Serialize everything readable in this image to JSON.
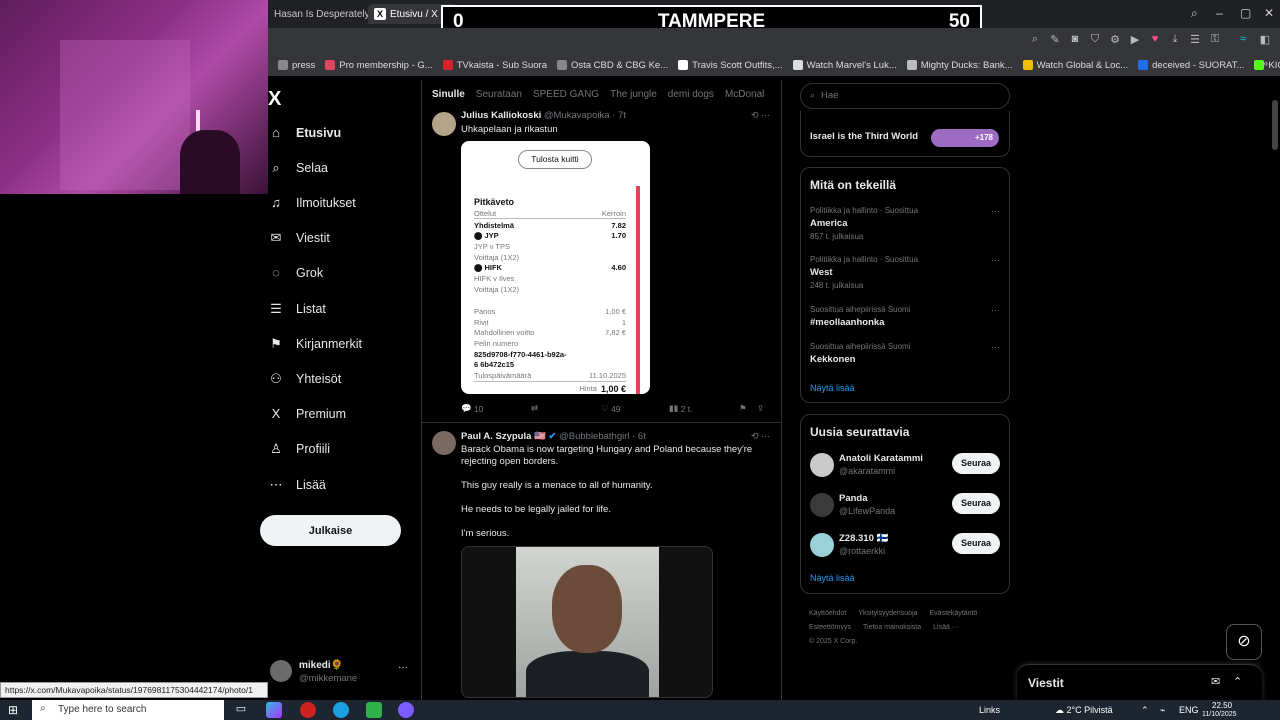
{
  "browser": {
    "tabs": [
      {
        "label": "Hasan Is Desperately Tryin"
      },
      {
        "label": "Etusivu / X"
      }
    ],
    "bookmarks": [
      {
        "label": "press",
        "color": "#888"
      },
      {
        "label": "Pro membership - G...",
        "color": "#e0455e"
      },
      {
        "label": "TVkaista - Sub Suora",
        "color": "#d4232a"
      },
      {
        "label": "Osta CBD & CBG Ke...",
        "color": "#888"
      },
      {
        "label": "Travis Scott Outfits,...",
        "color": "#fff"
      },
      {
        "label": "Watch Marvel's Luk...",
        "color": "#ddd"
      },
      {
        "label": "Mighty Ducks: Bank...",
        "color": "#bbb"
      },
      {
        "label": "Watch Global & Loc...",
        "color": "#f0c000"
      },
      {
        "label": "deceived - SUORAT...",
        "color": "#1d6ff0"
      },
      {
        "label": "KICK Status Page",
        "color": "#53fc18"
      }
    ],
    "status_url": "https://x.com/Mukavapoika/status/1976981175304442174/photo/1"
  },
  "scoreboard": {
    "left": "0",
    "title": "TAMMPERE",
    "right": "50"
  },
  "nav": {
    "logo": "X",
    "items": [
      {
        "label": "Etusivu",
        "icon": "home-icon",
        "glyph": "⌂"
      },
      {
        "label": "Selaa",
        "icon": "search-icon",
        "glyph": "⌕"
      },
      {
        "label": "Ilmoitukset",
        "icon": "bell-icon",
        "glyph": "♫"
      },
      {
        "label": "Viestit",
        "icon": "mail-icon",
        "glyph": "✉"
      },
      {
        "label": "Grok",
        "icon": "grok-icon",
        "glyph": "◌"
      },
      {
        "label": "Listat",
        "icon": "list-icon",
        "glyph": "☰"
      },
      {
        "label": "Kirjanmerkit",
        "icon": "bookmark-icon",
        "glyph": "⚑"
      },
      {
        "label": "Yhteisöt",
        "icon": "people-icon",
        "glyph": "⚇"
      },
      {
        "label": "Premium",
        "icon": "x-icon",
        "glyph": "X"
      },
      {
        "label": "Profiili",
        "icon": "profile-icon",
        "glyph": "♙"
      },
      {
        "label": "Lisää",
        "icon": "more-icon",
        "glyph": "⋯"
      }
    ],
    "post_label": "Julkaise",
    "account": {
      "name": "mikedi🌻",
      "handle": "@mikkemane"
    }
  },
  "feed": {
    "tabs": [
      "Sinulle",
      "Seurataan",
      "SPEED GANG",
      "The jungle",
      "demi dogs",
      "McDonal"
    ],
    "tweet1": {
      "name": "Julius Kalliokoski",
      "handle": "@Mukavapoika · 7t",
      "text": "Uhkapelaan ja rikastun",
      "receipt": {
        "button": "Tulosta kuitti",
        "title": "Pitkäveto",
        "col_left": "Ottelut",
        "col_right": "Kerroin",
        "rows": [
          {
            "l": "Yhdistelmä",
            "r": "7.82",
            "cls": "bold"
          },
          {
            "l": "⬤ JYP",
            "r": "1.70",
            "cls": "bold"
          },
          {
            "l": "JYP v TPS",
            "r": "",
            "cls": "muted"
          },
          {
            "l": "Voittaja (1X2)",
            "r": "",
            "cls": "muted"
          },
          {
            "l": "⬤ HIFK",
            "r": "4.60",
            "cls": "bold"
          },
          {
            "l": "HIFK v Ilves",
            "r": "",
            "cls": "muted"
          },
          {
            "l": "Voittaja (1X2)",
            "r": "",
            "cls": "muted"
          },
          {
            "l": "Panos",
            "r": "1,00 €",
            "cls": "muted"
          },
          {
            "l": "Rivit",
            "r": "1",
            "cls": "muted"
          },
          {
            "l": "Mahdollinen voitto",
            "r": "7,82 €",
            "cls": "muted"
          },
          {
            "l": "Pelin numero",
            "r": "",
            "cls": "muted"
          },
          {
            "l": "825d9708-f770-4461-b92a-",
            "r": "",
            "cls": "bold"
          },
          {
            "l": "6  6b472c15",
            "r": "",
            "cls": "bold"
          },
          {
            "l": "Tulospäivämäärä",
            "r": "11.10.2025",
            "cls": "muted"
          }
        ],
        "price_label": "Hinta",
        "price": "1,00 €"
      },
      "replies": "10",
      "reposts": "",
      "likes": "49",
      "views": "2 t."
    },
    "tweet2": {
      "name": "Paul A. Szypula 🇺🇸",
      "handle": "@Bubblebathgirl · 6t",
      "paragraphs": [
        "Barack Obama is now targeting Hungary and Poland because they're rejecting open borders.",
        "This guy really is a menace to all of humanity.",
        "He needs to be legally jailed for life.",
        "I'm serious."
      ]
    }
  },
  "side": {
    "search_placeholder": "Hae",
    "top_trend": {
      "title": "Israel is the Third World",
      "count": "+178"
    },
    "trends_title": "Mitä on tekeillä",
    "trends": [
      {
        "cat": "Politiikka ja hallinto · Suosittua",
        "title": "America",
        "count": "857 t. julkaisua"
      },
      {
        "cat": "Politiikka ja hallinto · Suosittua",
        "title": "West",
        "count": "248 t. julkaisua"
      },
      {
        "cat": "Suosittua aihepiirissä Suomi",
        "title": "#meollaanhonka",
        "count": ""
      },
      {
        "cat": "Suosittua aihepiirissä Suomi",
        "title": "Kekkonen",
        "count": ""
      }
    ],
    "show_more": "Näytä lisää",
    "follow_title": "Uusia seurattavia",
    "follows": [
      {
        "name": "Anatoli Karatammi",
        "handle": "@akaratammi",
        "btn": "Seuraa"
      },
      {
        "name": "Panda",
        "handle": "@LifewPanda",
        "btn": "Seuraa"
      },
      {
        "name": "Z28.310 🇫🇮",
        "handle": "@rottaerkki",
        "btn": "Seuraa"
      }
    ],
    "show_more2": "Näytä lisää",
    "footer": [
      "Käyttöehdot",
      "Yksityisyydensuoja",
      "Evästekäytäntö",
      "Esteettömyys",
      "Tietoa mainoksista",
      "Lisää ···",
      "© 2025 X Corp."
    ]
  },
  "messages": {
    "title": "Viestit"
  },
  "taskbar": {
    "search_placeholder": "Type here to search",
    "links": "Links",
    "weather": "2°C  Pilvistä",
    "lang": "ENG",
    "time": "22.50",
    "date": "11/10/2025"
  }
}
